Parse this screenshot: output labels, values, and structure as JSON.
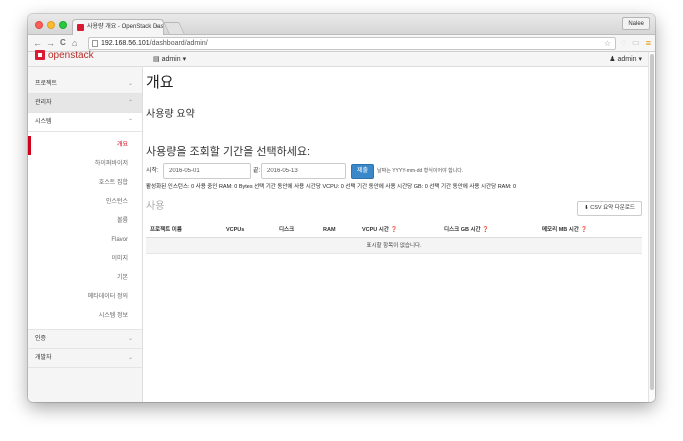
{
  "browser": {
    "tab_title": "사용량 개요 - OpenStack Das",
    "tab_close": "×",
    "profile_name": "Nalee",
    "url_host": "192.168.56.101",
    "url_path": "/dashboard/admin/",
    "back_icon": "←",
    "forward_icon": "→",
    "reload_icon": "C",
    "home_icon": "⌂",
    "star_icon": "☆",
    "menu_icon": "≡",
    "ext_icons": [
      "◌",
      "▭",
      "▣"
    ]
  },
  "topnav": {
    "logo_text": "openstack",
    "project_label": "admin",
    "user_label": "admin",
    "caret": "▾"
  },
  "sidebar": {
    "sections": [
      {
        "label": "프로젝트",
        "chevron": "⌄"
      },
      {
        "label": "관리자",
        "chevron": "⌃"
      },
      {
        "label": "시스템",
        "chevron": "⌃"
      }
    ],
    "items": [
      "개요",
      "하이퍼바이저",
      "호스트 집합",
      "인스턴스",
      "볼륨",
      "Flavor",
      "이미지",
      "기본",
      "메타데이터 정의",
      "시스템 정보"
    ],
    "footer_sections": [
      {
        "label": "인증",
        "chevron": "⌄"
      },
      {
        "label": "개발자",
        "chevron": "⌄"
      }
    ]
  },
  "main": {
    "title": "개요",
    "summary_heading": "사용량 요약",
    "period_heading": "사용량을 조회할 기간을 선택하세요:",
    "start_label": "시작:",
    "start_value": "2016-05-01",
    "end_label": "끝:",
    "end_value": "2016-05-13",
    "submit_label": "제출",
    "date_hint": "날짜는 YYYY-mm-dd 형식이어야 합니다.",
    "stats_text": "활성화된 인스턴스: 0 사용 중인 RAM: 0 Bytes 선택 기간 동안에 사용 시간당 VCPU: 0 선택 기간 동안에 사용 시간당 GB: 0 선택 기간 동안에 사용 시간당 RAM: 0",
    "usage_title": "사용",
    "csv_button": "CSV 요약 다운로드",
    "csv_icon": "⬇",
    "table": {
      "columns": [
        "프로젝트 이름",
        "VCPUs",
        "디스크",
        "RAM",
        "VCPU 시간 ❓",
        "디스크 GB 시간 ❓",
        "메모리 MB 시간 ❓"
      ],
      "empty_message": "표시할 항목이 없습니다."
    }
  }
}
